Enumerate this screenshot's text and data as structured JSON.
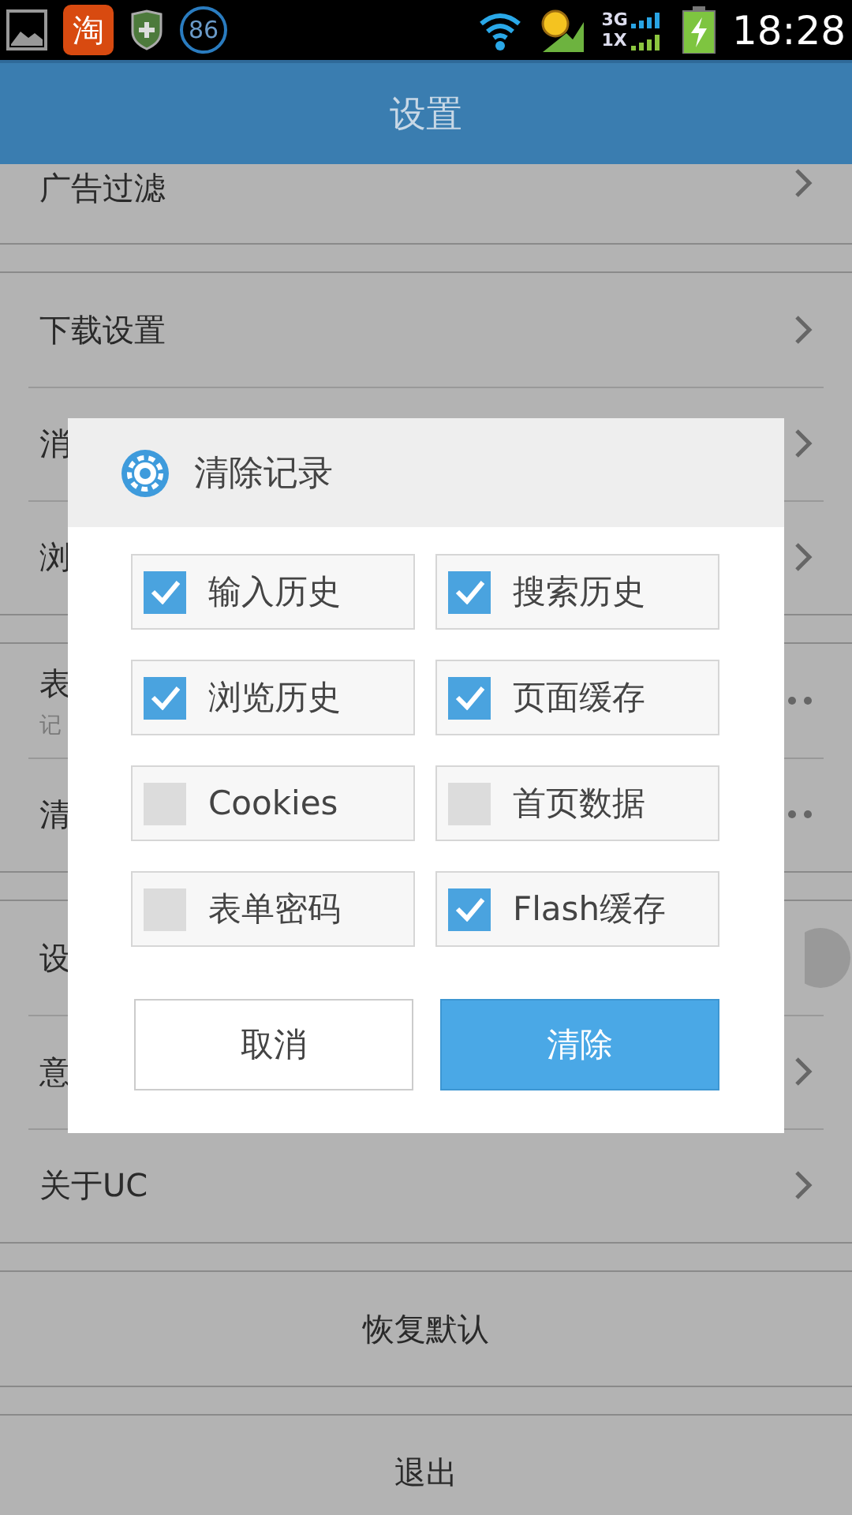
{
  "status_bar": {
    "app_badge": "淘",
    "counter": "86",
    "network_top": "3G",
    "network_bottom": "1X",
    "time": "18:28"
  },
  "header": {
    "title": "设置"
  },
  "sections": [
    {
      "rows": [
        {
          "label": "广告过滤",
          "kind": "chevron"
        }
      ]
    },
    {
      "rows": [
        {
          "label": "下载设置",
          "kind": "chevron"
        },
        {
          "label": "消",
          "kind": "chevron"
        },
        {
          "label": "浏",
          "kind": "chevron"
        }
      ]
    },
    {
      "rows": [
        {
          "label": "表",
          "subtitle": "记",
          "kind": "dots"
        },
        {
          "label": "清",
          "kind": "dots"
        }
      ]
    },
    {
      "rows": [
        {
          "label": "设",
          "kind": "toggle",
          "on": false
        },
        {
          "label": "意",
          "kind": "chevron"
        },
        {
          "label": "关于UC",
          "kind": "chevron"
        }
      ]
    },
    {
      "rows": [
        {
          "label": "恢复默认",
          "kind": "center"
        }
      ]
    },
    {
      "rows": [
        {
          "label": "退出",
          "kind": "center"
        }
      ]
    }
  ],
  "dialog": {
    "title": "清除记录",
    "options": [
      {
        "label": "输入历史",
        "checked": true
      },
      {
        "label": "搜索历史",
        "checked": true
      },
      {
        "label": "浏览历史",
        "checked": true
      },
      {
        "label": "页面缓存",
        "checked": true
      },
      {
        "label": "Cookies",
        "checked": false
      },
      {
        "label": "首页数据",
        "checked": false
      },
      {
        "label": "表单密码",
        "checked": false
      },
      {
        "label": "Flash缓存",
        "checked": true
      }
    ],
    "buttons": [
      {
        "label": "取消",
        "kind": "secondary"
      },
      {
        "label": "清除",
        "kind": "primary"
      }
    ]
  }
}
